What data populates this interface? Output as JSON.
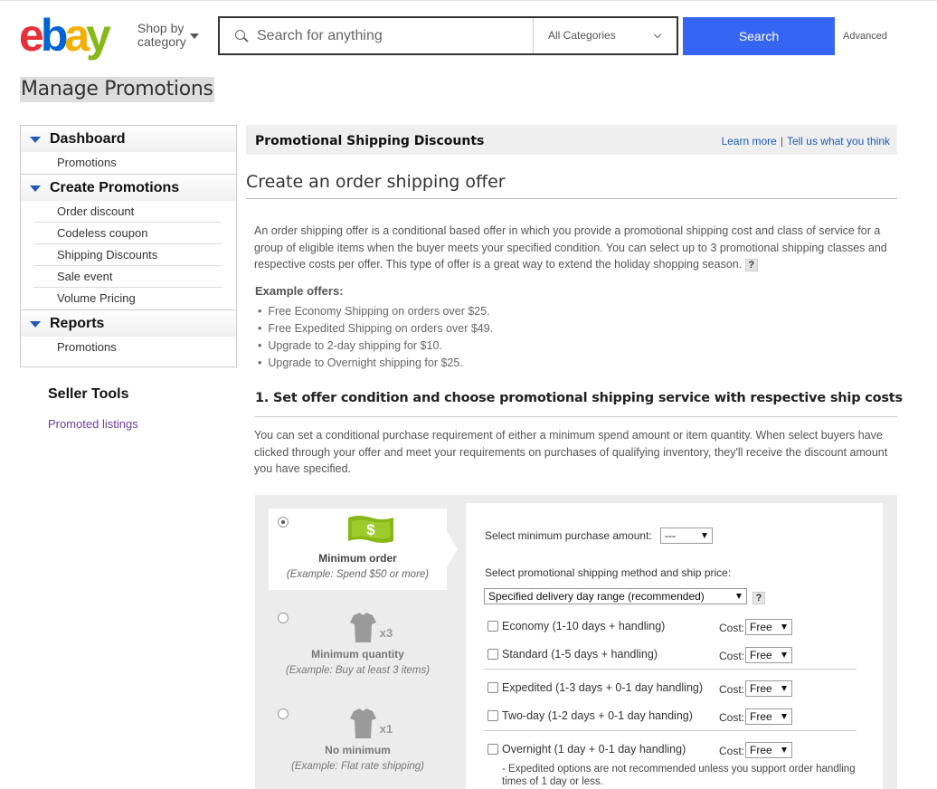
{
  "header": {
    "logo_letters": [
      "e",
      "b",
      "a",
      "y"
    ],
    "logo_colors": [
      "#e53238",
      "#0064d2",
      "#f5af02",
      "#86b817"
    ],
    "shop_by_line1": "Shop by",
    "shop_by_line2": "category",
    "search_placeholder": "Search for anything",
    "category_value": "All Categories",
    "search_button": "Search",
    "advanced_link": "Advanced",
    "accent_color": "#3665f3"
  },
  "page_title": "Manage Promotions",
  "sidebar": {
    "sections": [
      {
        "title": "Dashboard",
        "items": [
          "Promotions"
        ]
      },
      {
        "title": "Create Promotions",
        "items": [
          "Order discount",
          "Codeless coupon",
          "Shipping Discounts",
          "Sale event",
          "Volume Pricing"
        ]
      },
      {
        "title": "Reports",
        "items": [
          "Promotions"
        ]
      }
    ],
    "seller_tools": "Seller Tools",
    "promoted_listings": "Promoted listings"
  },
  "main": {
    "bar_title": "Promotional Shipping Discounts",
    "learn_more": "Learn more",
    "tell_us": "Tell us what you think",
    "create_title": "Create an order shipping offer",
    "description": "An order shipping offer is a conditional based offer in which you provide a promotional shipping cost and class of service for a group of eligible items when the buyer meets your specified condition. You can select up to 3 promotional shipping classes and respective costs per offer. This type of offer is a great way to extend the holiday shopping season.",
    "help_mark": "?",
    "examples_title": "Example offers:",
    "examples": [
      "Free Economy Shipping on orders over $25.",
      "Free Expedited Shipping on orders over $49.",
      "Upgrade to 2-day shipping for $10.",
      "Upgrade to Overnight shipping for $25."
    ],
    "step1_title": "1. Set offer condition and choose promotional shipping service with respective ship costs",
    "step1_desc": "You can set a conditional purchase requirement of either a minimum spend amount or item quantity. When select buyers have clicked through your offer and meet your requirements on purchases of qualifying inventory, they'll receive the discount amount you have specified."
  },
  "conditions": [
    {
      "title": "Minimum order",
      "example": "(Example: Spend $50 or more)",
      "selected": true,
      "icon": "money-icon",
      "icon_text": "$"
    },
    {
      "title": "Minimum quantity",
      "example": "(Example: Buy at least 3 items)",
      "selected": false,
      "icon": "shirt-icon",
      "icon_text": "x3"
    },
    {
      "title": "No minimum",
      "example": "(Example: Flat rate shipping)",
      "selected": false,
      "icon": "shirt-icon",
      "icon_text": "x1"
    }
  ],
  "offer_panel": {
    "min_purchase_label": "Select minimum purchase amount:",
    "min_purchase_value": "---",
    "method_label": "Select promotional shipping method and ship price:",
    "method_value": "Specified delivery day range (recommended)",
    "cost_label": "Cost:",
    "services": [
      {
        "name": "Economy (1-10 days + handling)",
        "cost": "Free",
        "checked": false
      },
      {
        "name": "Standard (1-5 days + handling)",
        "cost": "Free",
        "checked": false
      },
      {
        "name": "Expedited (1-3 days + 0-1 day handling)",
        "cost": "Free",
        "checked": false
      },
      {
        "name": "Two-day (1-2 days + 0-1 day handing)",
        "cost": "Free",
        "checked": false
      },
      {
        "name": "Overnight (1 day + 0-1 day handling)",
        "cost": "Free",
        "checked": false
      }
    ],
    "note": "- Expedited options are not recommended unless you support order handling times of 1 day or less.",
    "money_green": "#86b817"
  }
}
